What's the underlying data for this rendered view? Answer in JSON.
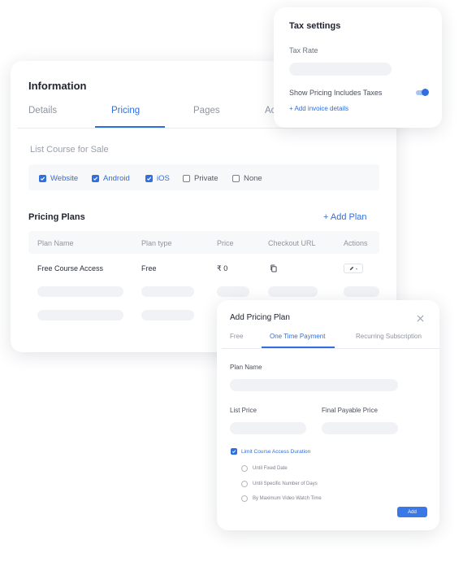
{
  "main": {
    "title": "Information",
    "tabs": [
      {
        "label": "Details"
      },
      {
        "label": "Pricing"
      },
      {
        "label": "Pages"
      },
      {
        "label": "Ac"
      }
    ],
    "list_course_label": "List Course for Sale",
    "sale_options": [
      {
        "label": "Website",
        "checked": true
      },
      {
        "label": "Android",
        "checked": true
      },
      {
        "label": "iOS",
        "checked": true
      },
      {
        "label": "Private",
        "checked": false
      },
      {
        "label": "None",
        "checked": false
      }
    ],
    "pricing_plans_title": "Pricing Plans",
    "add_plan_label": "+ Add Plan",
    "table": {
      "headers": [
        "Plan Name",
        "Plan type",
        "Price",
        "Checkout URL",
        "Actions"
      ],
      "rows": [
        {
          "plan_name": "Free Course Access",
          "plan_type": "Free",
          "price": "₹ 0",
          "action_suffix": "-"
        }
      ]
    }
  },
  "tax": {
    "title": "Tax settings",
    "tax_rate_label": "Tax Rate",
    "show_label": "Show  Pricing Includes Taxes",
    "toggle_on": true,
    "add_invoice_label": "+ Add invoice details"
  },
  "plan_dialog": {
    "title": "Add Pricing Plan",
    "tabs": [
      {
        "label": "Free"
      },
      {
        "label": "One Time Payment"
      },
      {
        "label": "Recurring Subscription"
      }
    ],
    "plan_name_label": "Plan Name",
    "list_price_label": "List Price",
    "final_price_label": "Final Payable Price",
    "limit_label": "Limit Course Access Duration",
    "options": [
      {
        "label": "Until Fixed Date"
      },
      {
        "label": "Until Specific Number of Days"
      },
      {
        "label": "By Maximum Video Watch Time"
      }
    ],
    "add_button": "Add"
  },
  "colors": {
    "accent": "#2f6fe0",
    "skeleton": "#f0f2f5"
  }
}
